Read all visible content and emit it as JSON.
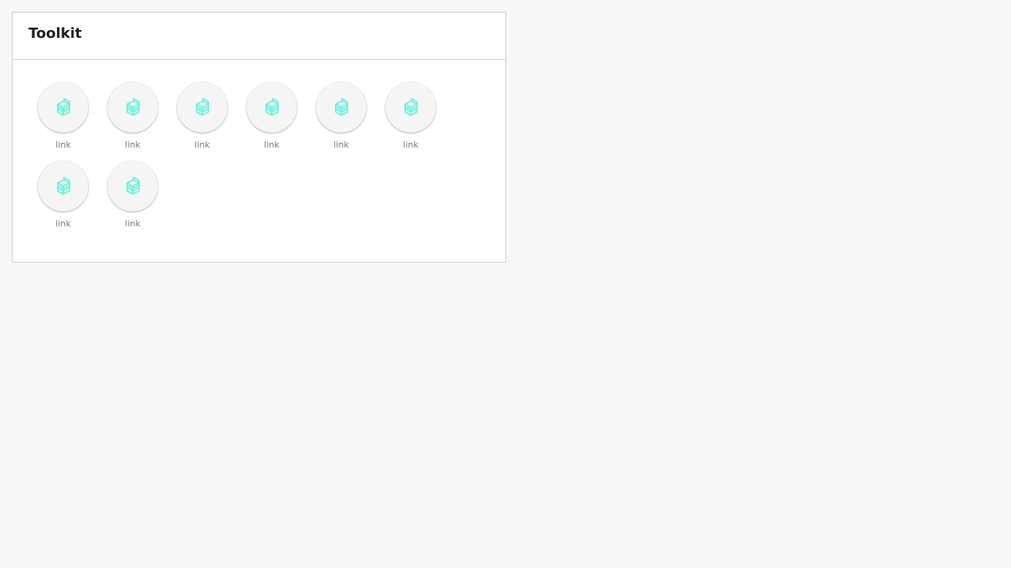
{
  "panel": {
    "title": "Toolkit"
  },
  "colors": {
    "background": "#f7f7f7",
    "panel": "#ffffff",
    "border": "#cfcfcf",
    "icon_accent": "#5ff2df",
    "label": "#777777"
  },
  "tiles": [
    {
      "label": "link",
      "icon": "stacked-blocks-icon"
    },
    {
      "label": "link",
      "icon": "stacked-blocks-icon"
    },
    {
      "label": "link",
      "icon": "stacked-blocks-icon"
    },
    {
      "label": "link",
      "icon": "stacked-blocks-icon"
    },
    {
      "label": "link",
      "icon": "stacked-blocks-icon"
    },
    {
      "label": "link",
      "icon": "stacked-blocks-icon"
    },
    {
      "label": "link",
      "icon": "stacked-blocks-icon"
    },
    {
      "label": "link",
      "icon": "stacked-blocks-icon"
    }
  ]
}
